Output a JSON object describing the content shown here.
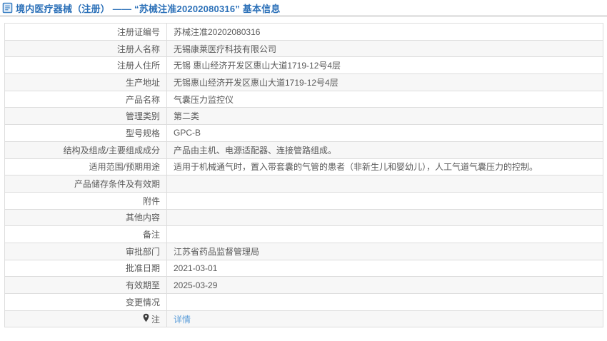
{
  "page": {
    "title": "境内医疗器械（注册） —— “苏械注准20202080316” 基本信息"
  },
  "icons": {
    "header": "document-icon",
    "note_label": "pin-icon"
  },
  "colors": {
    "title_blue": "#2b70b8",
    "link_blue": "#5b9dd9",
    "text_gray": "#595959",
    "border_gray": "#dddddd",
    "stripe_gray": "#f7f7f7",
    "header_divider": "#e4e4e4"
  },
  "table": {
    "rows": [
      {
        "label": "注册证编号",
        "value": "苏械注准20202080316"
      },
      {
        "label": "注册人名称",
        "value": "无锡康莱医疗科技有限公司"
      },
      {
        "label": "注册人住所",
        "value": "无锡 惠山经济开发区惠山大道1719-12号4层"
      },
      {
        "label": "生产地址",
        "value": "无锡惠山经济开发区惠山大道1719-12号4层"
      },
      {
        "label": "产品名称",
        "value": "气囊压力监控仪"
      },
      {
        "label": "管理类别",
        "value": "第二类"
      },
      {
        "label": "型号规格",
        "value": "GPC-B"
      },
      {
        "label": "结构及组成/主要组成成分",
        "value": "产品由主机、电源适配器、连接管路组成。"
      },
      {
        "label": "适用范围/预期用途",
        "value": "适用于机械通气时，置入带套囊的气管的患者（非新生儿和婴幼儿），人工气道气囊压力的控制。"
      },
      {
        "label": "产品储存条件及有效期",
        "value": ""
      },
      {
        "label": "附件",
        "value": ""
      },
      {
        "label": "其他内容",
        "value": ""
      },
      {
        "label": "备注",
        "value": ""
      },
      {
        "label": "审批部门",
        "value": "江苏省药品监督管理局"
      },
      {
        "label": "批准日期",
        "value": "2021-03-01"
      },
      {
        "label": "有效期至",
        "value": "2025-03-29"
      },
      {
        "label": "变更情况",
        "value": ""
      },
      {
        "label": "注",
        "value": "详情"
      }
    ]
  }
}
